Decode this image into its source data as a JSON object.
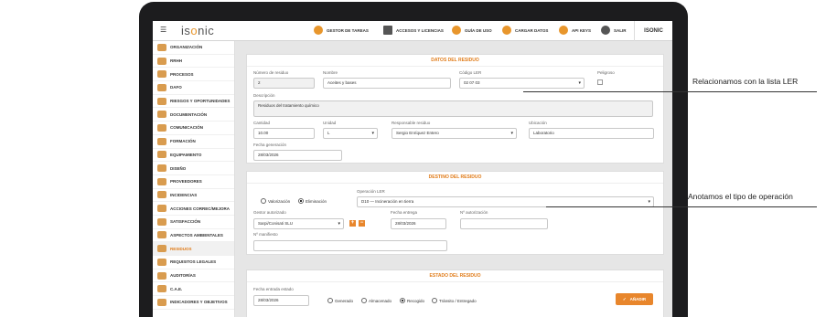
{
  "app": {
    "logo_pre": "is",
    "logo_o": "o",
    "logo_post": "nic",
    "menu_icon": "menu-icon",
    "user": "ISONIC"
  },
  "topbar": {
    "items": [
      {
        "label": "GESTOR DE TAREAS",
        "icon": "tasks-icon"
      },
      {
        "label": "ACCESOS Y LICENCIAS",
        "icon": "books-icon"
      },
      {
        "label": "GUÍA DE USO",
        "icon": "info-icon"
      },
      {
        "label": "CARGAR DATOS",
        "icon": "upload-icon"
      },
      {
        "label": "API KEYS",
        "icon": "key-icon"
      },
      {
        "label": "SALIR",
        "icon": "power-icon"
      }
    ]
  },
  "sidebar": {
    "items": [
      {
        "label": "ORGANIZACIÓN"
      },
      {
        "label": "RRHH"
      },
      {
        "label": "PROCESOS"
      },
      {
        "label": "DAFO"
      },
      {
        "label": "RIESGOS Y OPORTUNIDADES"
      },
      {
        "label": "DOCUMENTACIÓN"
      },
      {
        "label": "COMUNICACIÓN"
      },
      {
        "label": "FORMACIÓN"
      },
      {
        "label": "EQUIPAMIENTO"
      },
      {
        "label": "DISEÑO"
      },
      {
        "label": "PROVEEDORES"
      },
      {
        "label": "INCIDENCIAS"
      },
      {
        "label": "ACCIONES CORREC/MEJORA"
      },
      {
        "label": "SATISFACCIÓN"
      },
      {
        "label": "ASPECTOS AMBIENTALES"
      },
      {
        "label": "RESIDUOS"
      },
      {
        "label": "REQUISITOS LEGALES"
      },
      {
        "label": "AUDITORÍAS"
      },
      {
        "label": "C.A.E."
      },
      {
        "label": "INDICADORES Y OBJETIVOS"
      }
    ],
    "active": "RESIDUOS"
  },
  "datos": {
    "title": "DATOS DEL RESIDUO",
    "numero_label": "Número de residuo",
    "numero_value": "2",
    "nombre_label": "Nombre",
    "nombre_value": "Aceites y bases",
    "ler_label": "Código LER",
    "ler_value": "02 07 03",
    "peligroso_label": "Peligroso",
    "descripcion_label": "Descripción",
    "descripcion_value": "Residuos del tratamiento químico",
    "cantidad_label": "Cantidad",
    "cantidad_value": "10.00",
    "unidad_label": "Unidad",
    "unidad_value": "L",
    "responsable_label": "Responsable residuo",
    "responsable_value": "Sergio Enríquez Entero",
    "ubicacion_label": "Ubicación",
    "ubicacion_value": "Laboratorio",
    "fecha_gen_label": "Fecha generación",
    "fecha_gen_value": "28/03/2026"
  },
  "destino": {
    "title": "DESTINO DEL RESIDUO",
    "radio_valorizacion": "Valorización",
    "radio_eliminacion": "Eliminación",
    "selected": "Eliminación",
    "operacion_label": "Operación LER",
    "operacion_value": "D10 — Incineración en tierra",
    "gestor_label": "Gestor autorizado",
    "gestor_value": "Sarpi/Conisati SLU",
    "add_symbol": "+",
    "remove_symbol": "−",
    "fecha_entrega_label": "Fecha entrega",
    "fecha_entrega_value": "28/03/2026",
    "autorizacion_label": "Nº autorización",
    "autorizacion_value": "",
    "manifiesto_label": "Nº manifiesto",
    "manifiesto_value": ""
  },
  "estado": {
    "title": "ESTADO DEL RESIDUO",
    "fecha_label": "Fecha entrada estado",
    "fecha_value": "28/03/2026",
    "radios": [
      "Generado",
      "Almacenado",
      "Recogido",
      "Tránsito / Entregado"
    ],
    "selected": "Recogido",
    "add_button": "AÑADIR"
  },
  "annotations": {
    "first": "Relacionamos con la lista LER",
    "second": "Anotamos el tipo de operación"
  },
  "colors": {
    "accent": "#e8862c",
    "title": "#e07b18",
    "bezel": "#1c1c1e"
  }
}
